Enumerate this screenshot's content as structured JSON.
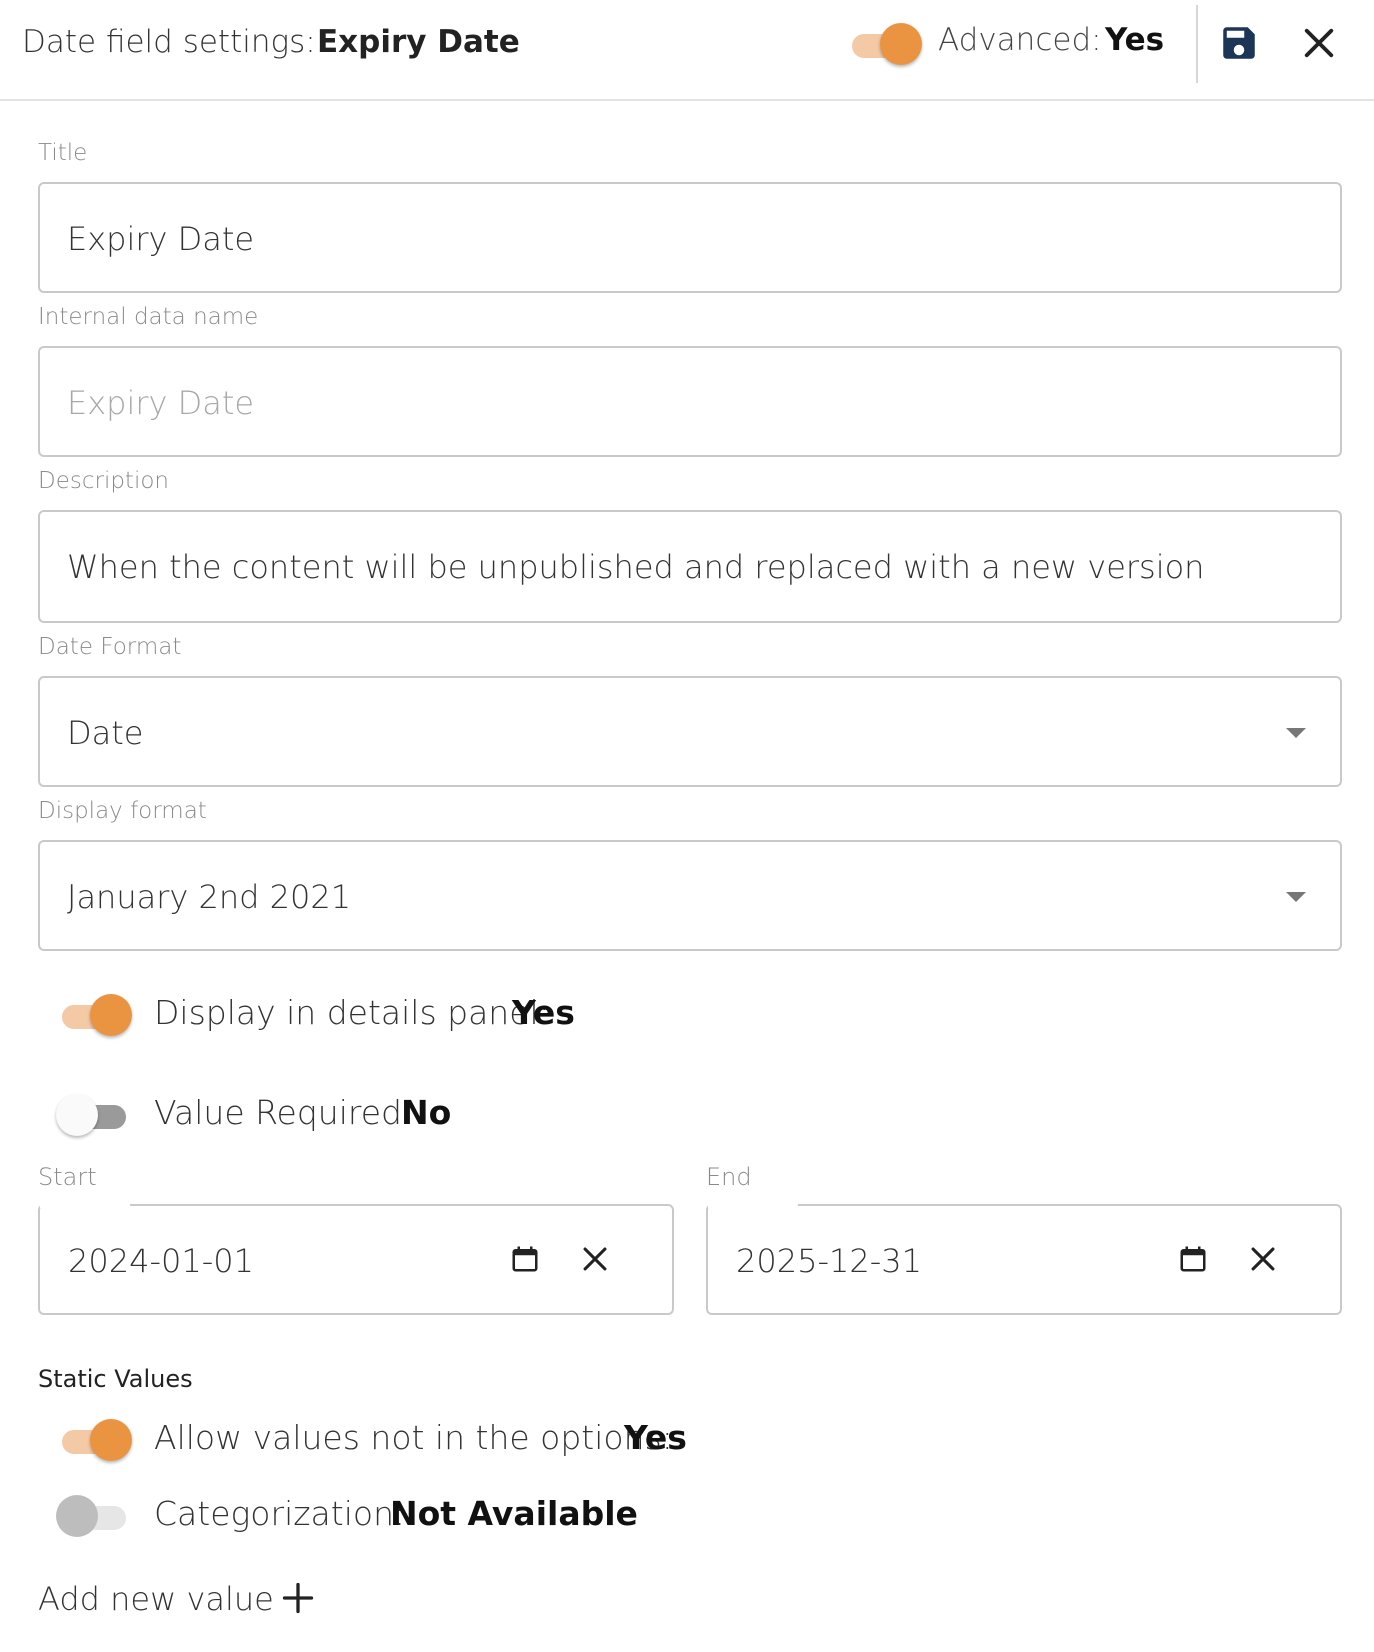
{
  "header": {
    "label": "Date field settings:",
    "field_name": "Expiry Date",
    "advanced_label": "Advanced:",
    "advanced_value": "Yes",
    "advanced_on": true,
    "save_icon": "save-icon",
    "close_icon": "close-icon"
  },
  "fields": {
    "title": {
      "label": "Title",
      "value": "Expiry Date"
    },
    "internal_name": {
      "label": "Internal data name",
      "placeholder": "Expiry Date"
    },
    "description": {
      "label": "Description",
      "value": "When the content will be unpublished and replaced with a new version"
    },
    "date_format": {
      "label": "Date Format",
      "value": "Date"
    },
    "display_format": {
      "label": "Display format",
      "value": "January 2nd 2021"
    }
  },
  "toggles": {
    "display_in_details": {
      "label": "Display in details panel:",
      "value": "Yes",
      "on": true
    },
    "value_required": {
      "label": "Value Required:",
      "value": "No",
      "on": false
    }
  },
  "range": {
    "start": {
      "label": "Start",
      "value": "2024-01-01"
    },
    "end": {
      "label": "End",
      "value": "2025-12-31"
    }
  },
  "static_values": {
    "title": "Static Values",
    "allow_values": {
      "label": "Allow values not in the options:",
      "value": "Yes",
      "on": true
    },
    "categorization": {
      "label": "Categorization:",
      "value": "Not Available",
      "on": false,
      "disabled": true
    },
    "add_new_value": "Add new value"
  },
  "colors": {
    "accent": "#ea9441",
    "accent_light": "#f3c9a6",
    "save_icon": "#1d3557"
  }
}
